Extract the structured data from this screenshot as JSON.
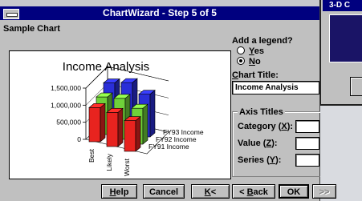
{
  "dialog": {
    "title": "ChartWizard - Step 5 of 5",
    "sample_chart_label": "Sample Chart",
    "legend": {
      "question": "Add a legend?",
      "options": [
        {
          "mnemonic": "Y",
          "rest": "es",
          "selected": false
        },
        {
          "mnemonic": "N",
          "rest": "o",
          "selected": true
        }
      ]
    },
    "chart_title": {
      "mnemonic": "C",
      "rest": "hart Title:",
      "value": "Income Analysis"
    },
    "axis_titles": {
      "label": "Axis Titles",
      "fields": [
        {
          "prefix": "Category (",
          "mnemonic": "X",
          "suffix": "):",
          "value": ""
        },
        {
          "prefix": "Value (",
          "mnemonic": "Z",
          "suffix": "):",
          "value": ""
        },
        {
          "prefix": "Series (",
          "mnemonic": "Y",
          "suffix": "):",
          "value": ""
        }
      ]
    },
    "buttons": {
      "help": {
        "mnemonic": "H",
        "rest": "elp"
      },
      "cancel": "Cancel",
      "first": {
        "mnemonic": "K",
        "rest": "<"
      },
      "back": {
        "prefix": "< ",
        "mnemonic": "B",
        "rest": "ack"
      },
      "ok": "OK",
      "next": ">>"
    }
  },
  "background_window": {
    "title": "3-D C"
  },
  "chart_data": {
    "type": "bar",
    "title": "Income Analysis",
    "categories": [
      "Best",
      "Likely",
      "Worst"
    ],
    "series": [
      {
        "name": "FY91 Income",
        "values": [
          1000000,
          1000000,
          900000
        ],
        "color": "#e8231f"
      },
      {
        "name": "FY92 Income",
        "values": [
          1100000,
          1200000,
          1050000
        ],
        "color": "#6fd13a"
      },
      {
        "name": "FY93 Income",
        "values": [
          1300000,
          1450000,
          1250000
        ],
        "color": "#2a2ed8"
      }
    ],
    "yticks": [
      "1,500,000",
      "1,000,000",
      "500,000",
      "0"
    ],
    "ylim": [
      0,
      1500000
    ],
    "grid": true
  }
}
